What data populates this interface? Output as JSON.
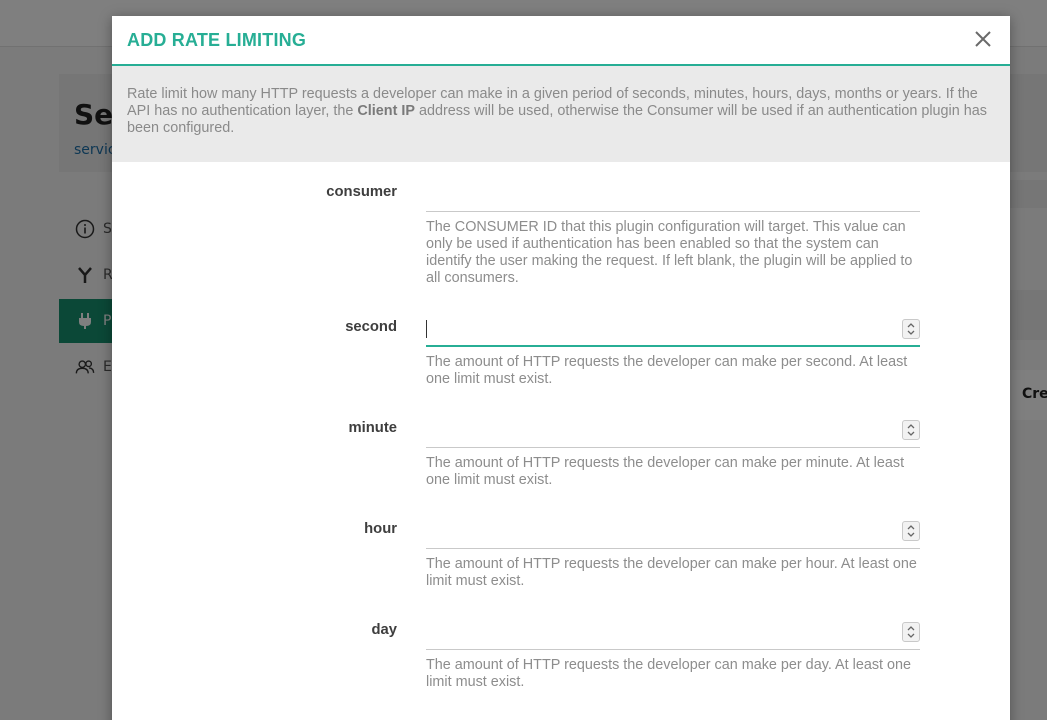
{
  "background": {
    "title": "Se",
    "subtitle": "servic",
    "nav": [
      {
        "label": "S",
        "icon": "info-icon"
      },
      {
        "label": "R",
        "icon": "routes-icon"
      },
      {
        "label": "P",
        "icon": "plug-icon",
        "active": true
      },
      {
        "label": "E",
        "icon": "users-icon"
      }
    ],
    "right_label": "Cre"
  },
  "modal": {
    "title": "ADD RATE LIMITING",
    "close_icon": "close-icon",
    "description": {
      "part1": "Rate limit how many HTTP requests a developer can make in a given period of seconds, minutes, hours, days, months or years. If the API has no authentication layer, the ",
      "bold": "Client IP",
      "part2": " address will be used, otherwise the Consumer will be used if an authentication plugin has been configured."
    },
    "fields": [
      {
        "label": "consumer",
        "value": "",
        "help": "The CONSUMER ID that this plugin configuration will target. This value can only be used if authentication has been enabled so that the system can identify the user making the request. If left blank, the plugin will be applied to all consumers."
      },
      {
        "label": "second",
        "value": "",
        "help": "The amount of HTTP requests the developer can make per second. At least one limit must exist."
      },
      {
        "label": "minute",
        "value": "",
        "help": "The amount of HTTP requests the developer can make per minute. At least one limit must exist."
      },
      {
        "label": "hour",
        "value": "",
        "help": "The amount of HTTP requests the developer can make per hour. At least one limit must exist."
      },
      {
        "label": "day",
        "value": "",
        "help": "The amount of HTTP requests the developer can make per day. At least one limit must exist."
      }
    ]
  },
  "colors": {
    "accent": "#27ae95",
    "active_nav": "#17906e"
  }
}
